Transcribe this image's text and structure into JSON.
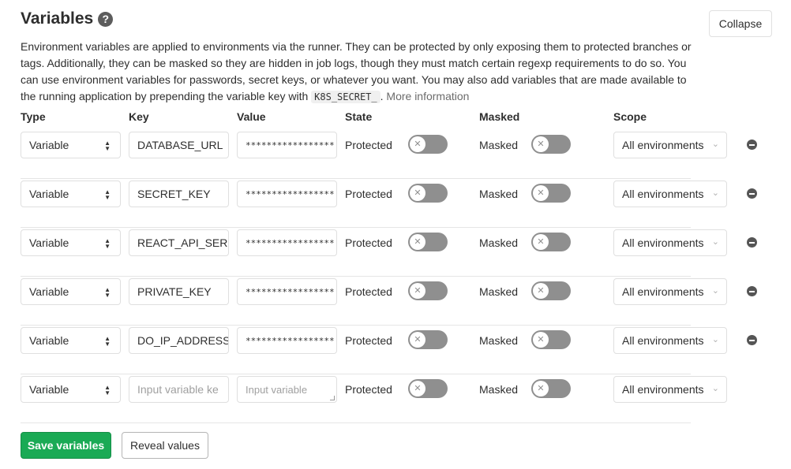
{
  "header": {
    "title": "Variables",
    "help_icon": "question-circle-icon",
    "collapse_label": "Collapse"
  },
  "description": {
    "text": "Environment variables are applied to environments via the runner. They can be protected by only exposing them to protected branches or tags. Additionally, they can be masked so they are hidden in job logs, though they must match certain regexp requirements to do so. You can use environment variables for passwords, secret keys, or whatever you want. You may also add variables that are made available to the running application by prepending the variable key with",
    "code": "K8S_SECRET_",
    "after_code": ".",
    "more_link": "More information"
  },
  "columns": {
    "type": "Type",
    "key": "Key",
    "value": "Value",
    "state": "State",
    "masked": "Masked",
    "scope": "Scope"
  },
  "rows": [
    {
      "type": "Variable",
      "key": "DATABASE_URL",
      "value": "*****************",
      "state": "Protected",
      "masked": "Masked",
      "scope": "All environments"
    },
    {
      "type": "Variable",
      "key": "SECRET_KEY",
      "value": "*****************",
      "state": "Protected",
      "masked": "Masked",
      "scope": "All environments"
    },
    {
      "type": "Variable",
      "key": "REACT_API_SER'",
      "value": "*****************",
      "state": "Protected",
      "masked": "Masked",
      "scope": "All environments"
    },
    {
      "type": "Variable",
      "key": "PRIVATE_KEY",
      "value": "*****************",
      "state": "Protected",
      "masked": "Masked",
      "scope": "All environments"
    },
    {
      "type": "Variable",
      "key": "DO_IP_ADDRESS",
      "value": "*****************",
      "state": "Protected",
      "masked": "Masked",
      "scope": "All environments"
    }
  ],
  "new_row": {
    "type": "Variable",
    "key_placeholder": "Input variable ke",
    "value_placeholder": "Input variable",
    "state": "Protected",
    "masked": "Masked",
    "scope": "All environments"
  },
  "buttons": {
    "save": "Save variables",
    "reveal": "Reveal values"
  },
  "colors": {
    "save_green": "#1aaa55",
    "toggle_off": "#8f8f8f"
  }
}
